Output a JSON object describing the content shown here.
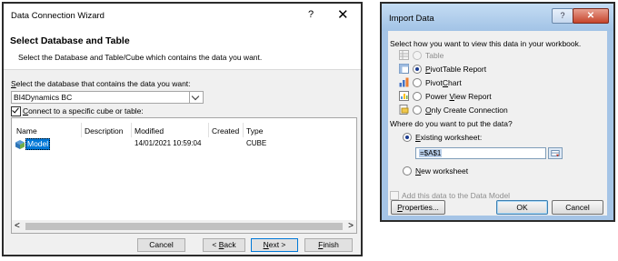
{
  "wizard": {
    "title": "Data Connection Wizard",
    "help_label": "?",
    "close_label": "✕",
    "heading": "Select Database and Table",
    "subheading": "Select the Database and Table/Cube which contains the data you want.",
    "db_label": "Select the database that contains the data you want:",
    "db_value": "BI4Dynamics BC",
    "cube_checkbox_label": "Connect to a specific cube or table:",
    "cube_checkbox_checked": true,
    "columns": [
      "Name",
      "Description",
      "Modified",
      "Created",
      "Type"
    ],
    "rows": [
      {
        "name": "Model",
        "description": "",
        "modified": "14/01/2021 10:59:04",
        "created": "",
        "type": "CUBE"
      }
    ],
    "scroll_left": "<",
    "scroll_right": ">",
    "buttons": {
      "cancel": "Cancel",
      "back": "< Back",
      "next": "Next >",
      "finish": "Finish"
    }
  },
  "import": {
    "title": "Import Data",
    "help_label": "?",
    "close_label": "✕",
    "view_prompt": "Select how you want to view this data in your workbook.",
    "view_options": [
      {
        "label": "Table",
        "icon": "table-icon",
        "state": "disabled"
      },
      {
        "label": "PivotTable Report",
        "icon": "pivottable-icon",
        "state": "selected"
      },
      {
        "label": "PivotChart",
        "icon": "pivotchart-icon",
        "state": "unselected"
      },
      {
        "label": "Power View Report",
        "icon": "powerview-icon",
        "state": "unselected"
      },
      {
        "label": "Only Create Connection",
        "icon": "connection-icon",
        "state": "unselected"
      }
    ],
    "location_prompt": "Where do you want to put the data?",
    "existing_label": "Existing worksheet:",
    "existing_value": "=$A$1",
    "new_label": "New worksheet",
    "data_model_label": "Add this data to the Data Model",
    "buttons": {
      "properties": "Properties...",
      "ok": "OK",
      "cancel": "Cancel"
    }
  }
}
